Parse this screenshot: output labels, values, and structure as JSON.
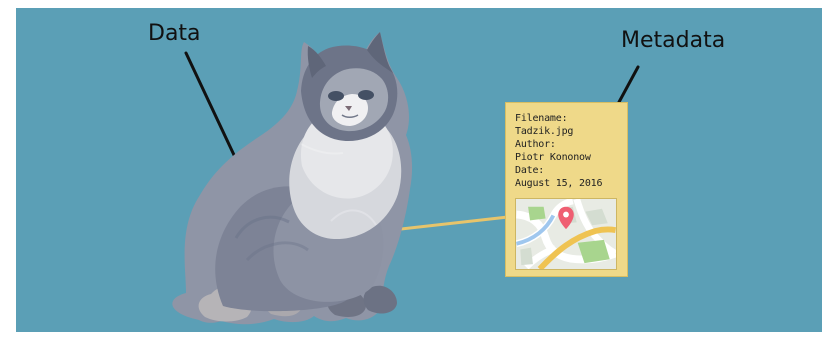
{
  "labels": {
    "data": "Data",
    "metadata": "Metadata"
  },
  "metadata_card": {
    "lines": [
      "Filename:",
      "Tadzik.jpg",
      "Author:",
      "Piotr Kononow",
      "Date:",
      "August 15, 2016"
    ]
  },
  "colors": {
    "background": "#5b9fb6",
    "card": "#efd989",
    "connector": "#e7c46b",
    "pin": "#ef5f72"
  },
  "icons": {
    "cat": "cat-illustration",
    "map": "map-thumbnail-icon",
    "pin": "map-pin-icon"
  }
}
